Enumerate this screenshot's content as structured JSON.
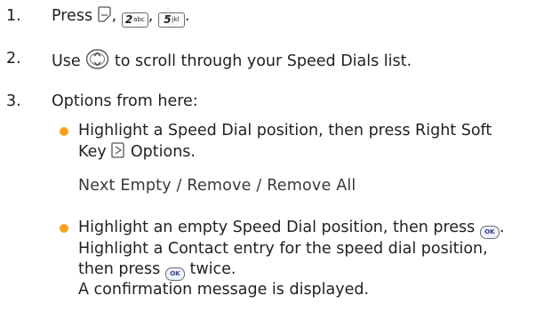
{
  "steps": [
    {
      "num": "1.",
      "prefix": "Press",
      "sep1": ",",
      "sep2": ",",
      "sep3": ".",
      "key2": {
        "digit": "2",
        "letters": "abc"
      },
      "key5": {
        "digit": "5",
        "letters": "jkl"
      }
    },
    {
      "num": "2.",
      "before": "Use",
      "after": "to scroll through your Speed Dials list."
    },
    {
      "num": "3.",
      "text": "Options from here:"
    }
  ],
  "bullets": [
    {
      "line1": "Highlight a Speed Dial position, then press Right Soft",
      "line2_prefix": "Key",
      "line2_suffix": "Options."
    },
    {
      "line1_prefix": "Highlight an empty Speed Dial position, then press",
      "line1_suffix": ".",
      "line2": "Highlight a Contact entry for the speed dial position,",
      "line3_prefix": "then press",
      "line3_suffix": "twice.",
      "line4": "A confirmation message is displayed."
    }
  ],
  "options_line": "Next Empty / Remove / Remove All",
  "ok_label": "OK",
  "icons": {
    "soft_key": "left-soft-key-icon",
    "right_soft_key": "right-soft-key-icon",
    "nav": "navigation-key-icon",
    "ok": "ok-key-icon"
  },
  "colors": {
    "bullet": "#f5a21f",
    "text": "#231f20"
  }
}
